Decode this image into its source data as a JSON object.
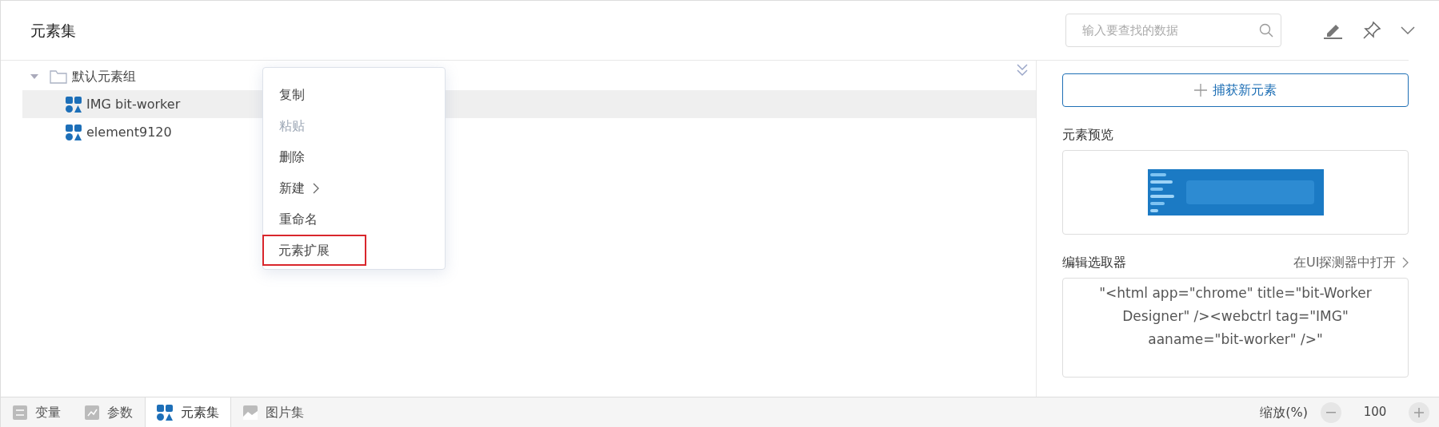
{
  "panel": {
    "title": "元素集",
    "search": {
      "placeholder": "输入要查找的数据"
    }
  },
  "tree": [
    {
      "label": "默认元素组",
      "kind": "group",
      "expanded": true,
      "selected": false,
      "children": [
        {
          "label": "IMG bit-worker",
          "kind": "element",
          "selected": true
        },
        {
          "label": "element9120",
          "kind": "element",
          "selected": false
        }
      ]
    }
  ],
  "context_menu": {
    "items": [
      {
        "label": "复制",
        "disabled": false,
        "submenu": false,
        "highlighted": false
      },
      {
        "label": "粘贴",
        "disabled": true,
        "submenu": false,
        "highlighted": false
      },
      {
        "label": "删除",
        "disabled": false,
        "submenu": false,
        "highlighted": false
      },
      {
        "label": "新建",
        "disabled": false,
        "submenu": true,
        "highlighted": false
      },
      {
        "label": "重命名",
        "disabled": false,
        "submenu": false,
        "highlighted": false
      },
      {
        "label": "元素扩展",
        "disabled": false,
        "submenu": false,
        "highlighted": true
      }
    ]
  },
  "side": {
    "capture_button": "捕获新元素",
    "preview_label": "元素预览",
    "selector_label": "编辑选取器",
    "open_link": "在UI探测器中打开",
    "selector_value": "\"<html app=\"chrome\" title=\"bit-Worker Designer\" /><webctrl tag=\"IMG\" aaname=\"bit-worker\" />\""
  },
  "bottom_tabs": [
    {
      "label": "变量",
      "kind": "variables",
      "selected": false
    },
    {
      "label": "参数",
      "kind": "parameters",
      "selected": false
    },
    {
      "label": "元素集",
      "kind": "elements",
      "selected": true
    },
    {
      "label": "图片集",
      "kind": "images",
      "selected": false
    }
  ],
  "zoom": {
    "label": "缩放(%)",
    "value": "100"
  }
}
